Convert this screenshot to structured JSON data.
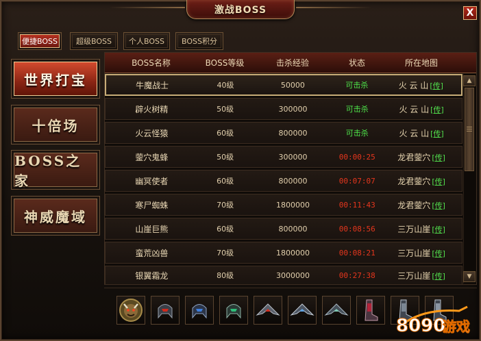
{
  "window": {
    "title": "激战BOSS",
    "close_label": "X"
  },
  "top_tabs": [
    {
      "label": "便捷BOSS",
      "active": true
    },
    {
      "label": "超级BOSS",
      "active": false
    },
    {
      "label": "个人BOSS",
      "active": false
    },
    {
      "label": "BOSS积分",
      "active": false
    }
  ],
  "categories": [
    {
      "label": "世界打宝",
      "active": true
    },
    {
      "label": "十倍场",
      "active": false
    },
    {
      "label": "BOSS之家",
      "active": false
    },
    {
      "label": "神威魔域",
      "active": false
    }
  ],
  "table": {
    "columns": [
      "BOSS名称",
      "BOSS等级",
      "击杀经验",
      "状态",
      "所在地图"
    ],
    "rows": [
      {
        "name": "牛魔战士",
        "level": "40级",
        "exp": "50000",
        "status": "可击杀",
        "map": "火 云 山",
        "tp": "[传]",
        "selected": true
      },
      {
        "name": "辟火树精",
        "level": "50级",
        "exp": "300000",
        "status": "可击杀",
        "map": "火 云 山",
        "tp": "[传]"
      },
      {
        "name": "火云怪猿",
        "level": "60级",
        "exp": "800000",
        "status": "可击杀",
        "map": "火 云 山",
        "tp": "[传]"
      },
      {
        "name": "蓥穴鬼蜂",
        "level": "50级",
        "exp": "300000",
        "status": "00:00:25",
        "map": "龙君蓥穴",
        "tp": "[传]"
      },
      {
        "name": "幽冥使者",
        "level": "60级",
        "exp": "800000",
        "status": "00:07:07",
        "map": "龙君蓥穴",
        "tp": "[传]"
      },
      {
        "name": "寒尸蜘蛛",
        "level": "70级",
        "exp": "1800000",
        "status": "00:11:43",
        "map": "龙君蓥穴",
        "tp": "[传]"
      },
      {
        "name": "山崖巨熊",
        "level": "60级",
        "exp": "800000",
        "status": "00:08:56",
        "map": "三万山崖",
        "tp": "[传]"
      },
      {
        "name": "蛮荒凶兽",
        "level": "70级",
        "exp": "1800000",
        "status": "00:08:21",
        "map": "三万山崖",
        "tp": "[传]"
      },
      {
        "name": "银翼霜龙",
        "level": "80级",
        "exp": "3000000",
        "status": "00:27:38",
        "map": "三万山崖",
        "tp": "[传]"
      }
    ]
  },
  "scroll": {
    "up": "▲",
    "down": "▼"
  },
  "reward_icons": [
    "beast-portrait-icon",
    "red-helmet-icon",
    "blue-helmet-icon",
    "green-helmet-icon",
    "red-wing-icon",
    "silver-wing-icon",
    "steel-wing-icon",
    "red-boots-icon",
    "silver-boots-icon",
    "silver-boots-icon"
  ],
  "watermark": {
    "text": "8090",
    "suffix": "游戏"
  },
  "colors": {
    "killable": "#4ee34a",
    "timer": "#e6361d",
    "teleport": "#52e04d",
    "active_tab": "#b4301f"
  }
}
